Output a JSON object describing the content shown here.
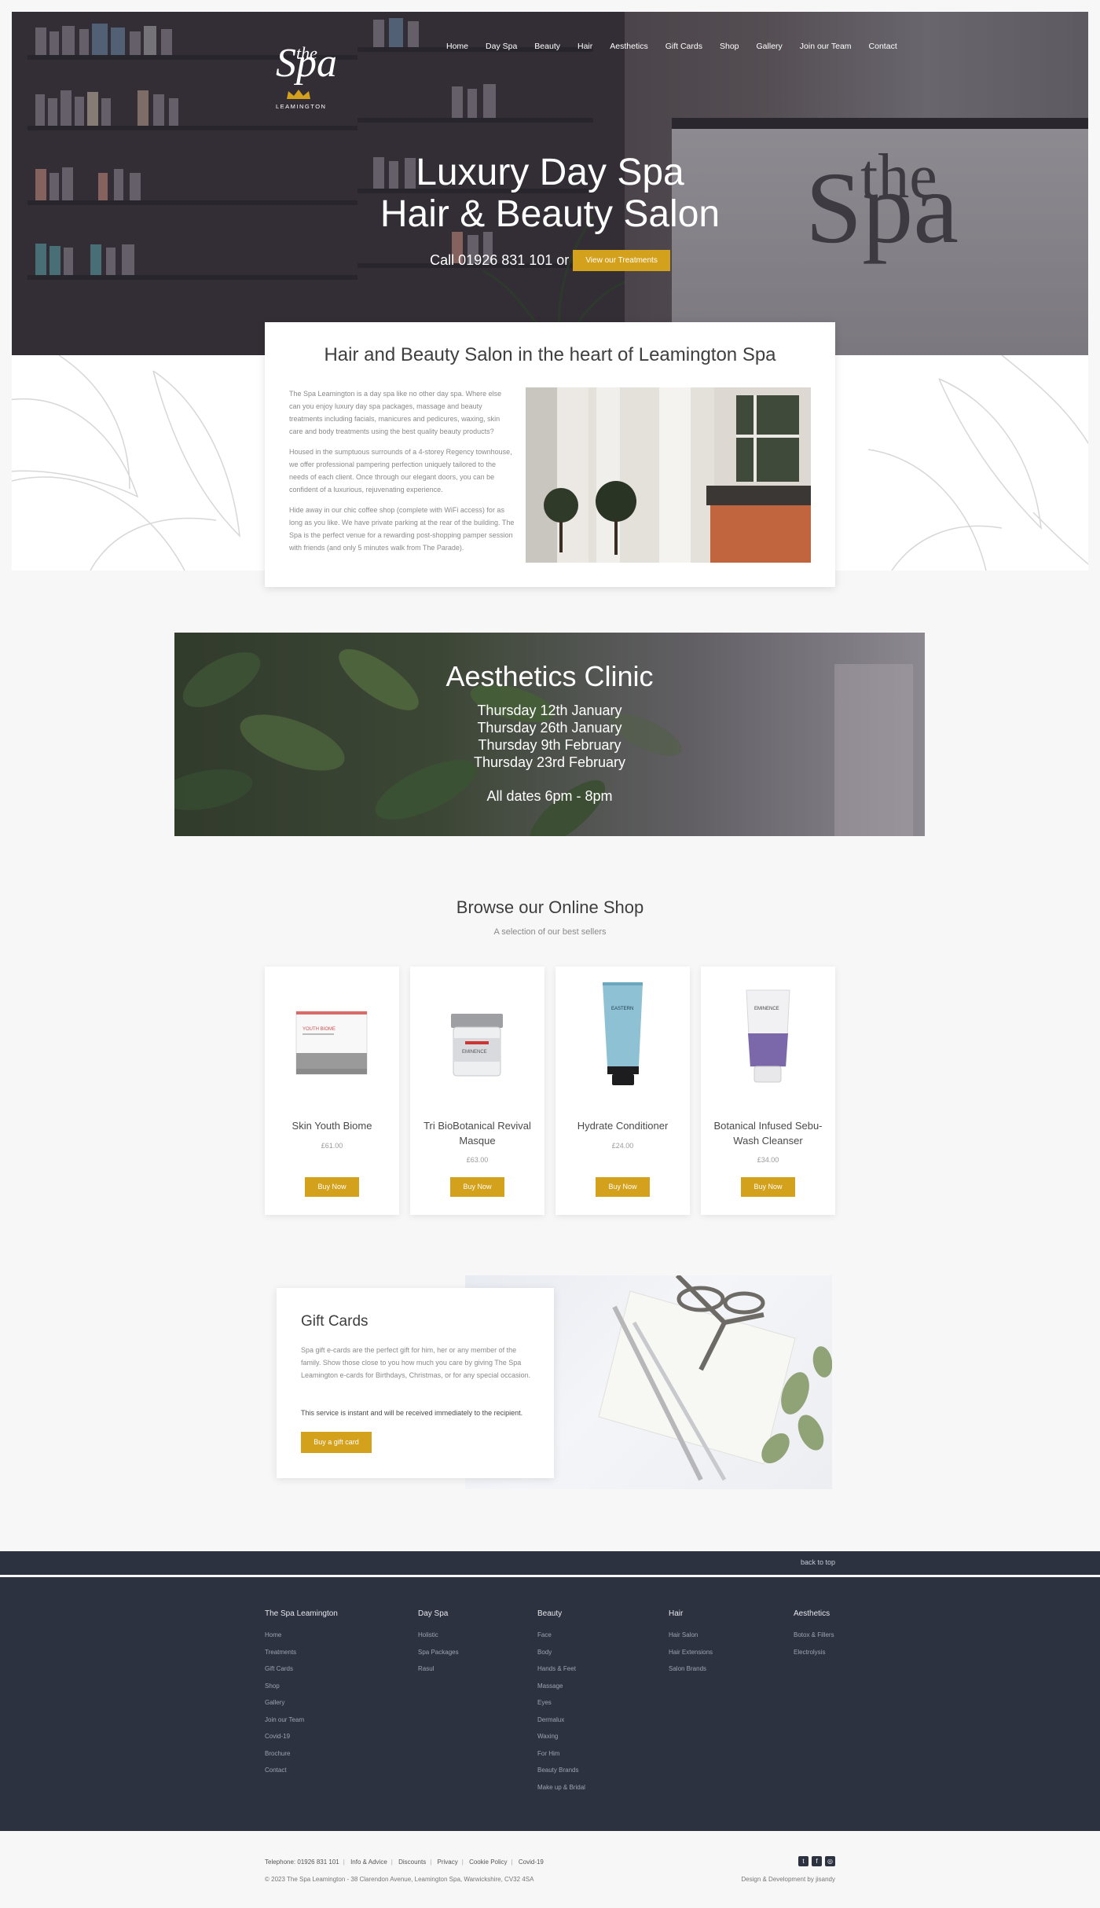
{
  "nav": {
    "logo": {
      "the": "the",
      "spa": "Spa",
      "town": "LEAMINGTON"
    },
    "items": [
      "Home",
      "Day Spa",
      "Beauty",
      "Hair",
      "Aesthetics",
      "Gift Cards",
      "Shop",
      "Gallery",
      "Join our Team",
      "Contact"
    ]
  },
  "hero": {
    "title_line1": "Luxury Day Spa",
    "title_line2": "Hair & Beauty Salon",
    "call_text": "Call 01926 831 101 or",
    "cta_label": "View our Treatments",
    "desk_logo_the": "the",
    "desk_logo_spa": "Spa"
  },
  "intro": {
    "heading": "Hair and Beauty Salon in the heart of Leamington Spa",
    "paragraphs": [
      "The Spa Leamington is a day spa like no other day spa. Where else can you enjoy luxury day spa packages, massage and beauty treatments including facials, manicures and pedicures, waxing, skin care and body treatments using the best quality beauty products?",
      "Housed in the sumptuous surrounds of a 4-storey Regency townhouse, we offer professional pampering perfection uniquely tailored to the needs of each client. Once through our elegant doors, you can be confident of a luxurious, rejuvenating experience.",
      "Hide away in our chic coffee shop (complete with WiFi access) for as long as you like. We have private parking at the rear of the building. The Spa is the perfect venue for a rewarding post-shopping pamper session with friends (and only 5 minutes walk from The Parade)."
    ]
  },
  "aesthetics": {
    "title": "Aesthetics Clinic",
    "dates": [
      "Thursday 12th January",
      "Thursday 26th January",
      "Thursday 9th February",
      "Thursday 23rd February"
    ],
    "hours": "All dates 6pm - 8pm"
  },
  "shop": {
    "title": "Browse our Online Shop",
    "subtitle": "A selection of our best sellers",
    "products": [
      {
        "name": "Skin Youth Biome",
        "price": "£61.00",
        "buy": "Buy Now"
      },
      {
        "name": "Tri BioBotanical Revival Masque",
        "price": "£63.00",
        "buy": "Buy Now"
      },
      {
        "name": "Hydrate Conditioner",
        "price": "£24.00",
        "buy": "Buy Now"
      },
      {
        "name": "Botanical Infused Sebu-Wash Cleanser",
        "price": "£34.00",
        "buy": "Buy Now"
      }
    ],
    "product_label_youth": "YOUTH BIOME",
    "product_label_eminence": "EMINENCE",
    "product_label_eastern": "EASTERN"
  },
  "gift": {
    "title": "Gift Cards",
    "text": "Spa gift e-cards are the perfect gift for him, her or any member of the family. Show those close to you how much you care by giving The Spa Leamington e-cards for Birthdays, Christmas, or for any special occasion.",
    "note": "This service is instant and will be received immediately to the recipient.",
    "button": "Buy a gift card"
  },
  "footer": {
    "back_to_top": "back to top",
    "columns": [
      {
        "title": "The Spa Leamington",
        "links": [
          "Home",
          "Treatments",
          "Gift Cards",
          "Shop",
          "Gallery",
          "Join our Team",
          "Covid-19",
          "Brochure",
          "Contact"
        ]
      },
      {
        "title": "Day Spa",
        "links": [
          "Holistic",
          "Spa Packages",
          "Rasul"
        ]
      },
      {
        "title": "Beauty",
        "links": [
          "Face",
          "Body",
          "Hands & Feet",
          "Massage",
          "Eyes",
          "Dermalux",
          "Waxing",
          "For Him",
          "Beauty Brands",
          "Make up & Bridal"
        ]
      },
      {
        "title": "Hair",
        "links": [
          "Hair Salon",
          "Hair Extensions",
          "Salon Brands"
        ]
      },
      {
        "title": "Aesthetics",
        "links": [
          "Botox & Fillers",
          "Electrolysis"
        ]
      }
    ],
    "bottom_links": [
      "Telephone: 01926 831 101",
      "Info & Advice",
      "Discounts",
      "Privacy",
      "Cookie Policy",
      "Covid-19"
    ],
    "copyright": "© 2023 The Spa Leamington - 38 Clarendon Avenue, Leamington Spa, Warwickshire, CV32 4SA",
    "credit": "Design & Development by jisandy",
    "social": [
      {
        "icon": "twitter-icon",
        "glyph": "t"
      },
      {
        "icon": "facebook-icon",
        "glyph": "f"
      },
      {
        "icon": "instagram-icon",
        "glyph": "◎"
      }
    ]
  },
  "colors": {
    "accent": "#d4a11c",
    "footer": "#2d3241"
  }
}
